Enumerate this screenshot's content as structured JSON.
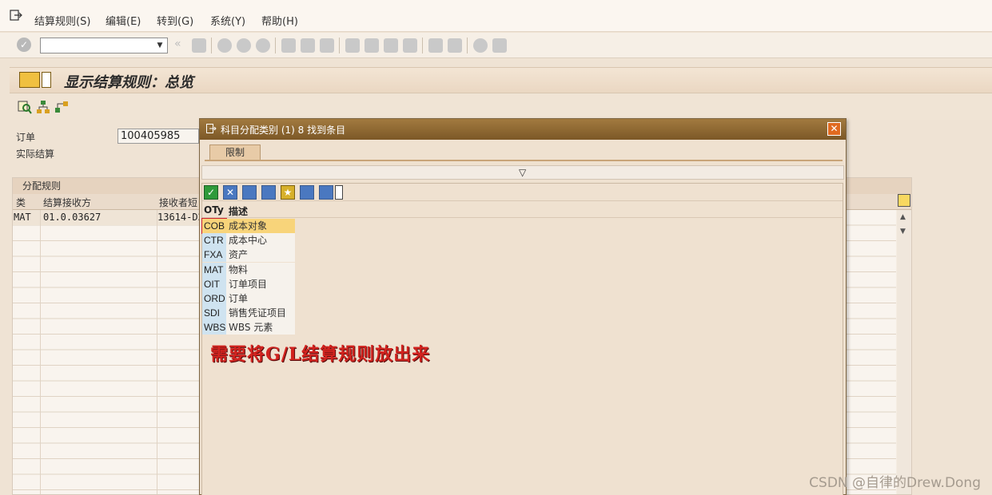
{
  "menu": {
    "items": [
      {
        "label": "结算规则(S)"
      },
      {
        "label": "编辑(E)"
      },
      {
        "label": "转到(G)"
      },
      {
        "label": "系统(Y)"
      },
      {
        "label": "帮助(H)"
      }
    ]
  },
  "toolbar": {
    "command_value": ""
  },
  "header": {
    "title": "显示结算规则：总览"
  },
  "form": {
    "order_label": "订单",
    "order_value": "100405985",
    "actual_settlement_label": "实际结算"
  },
  "rules_table": {
    "title": "分配规则",
    "columns": [
      "类",
      "结算接收方",
      "接收者短"
    ],
    "rows": [
      {
        "type": "MAT",
        "receiver": "01.0.03627",
        "receiver_short": "13614-D2"
      }
    ]
  },
  "popup": {
    "title": "科目分配类别 (1)   8 找到条目",
    "tab_label": "限制",
    "list_headers": {
      "code": "OTy",
      "desc": "描述"
    },
    "items": [
      {
        "code": "COB",
        "desc": "成本对象",
        "selected": true
      },
      {
        "code": "CTR",
        "desc": "成本中心"
      },
      {
        "code": "FXA",
        "desc": "资产"
      },
      {
        "code": "MAT",
        "desc": "物料"
      },
      {
        "code": "OIT",
        "desc": "订单项目"
      },
      {
        "code": "ORD",
        "desc": "订单"
      },
      {
        "code": "SDI",
        "desc": "销售凭证项目"
      },
      {
        "code": "WBS",
        "desc": "WBS 元素"
      }
    ],
    "annotation": "需要将G/L结算规则放出来"
  },
  "watermark": "CSDN @自律的Drew.Dong",
  "colors": {
    "popup_title_bg": "#8a6530",
    "selected_row": "#f8d47a",
    "code_cell": "#cfe3f0",
    "annotation": "#d2231f"
  }
}
